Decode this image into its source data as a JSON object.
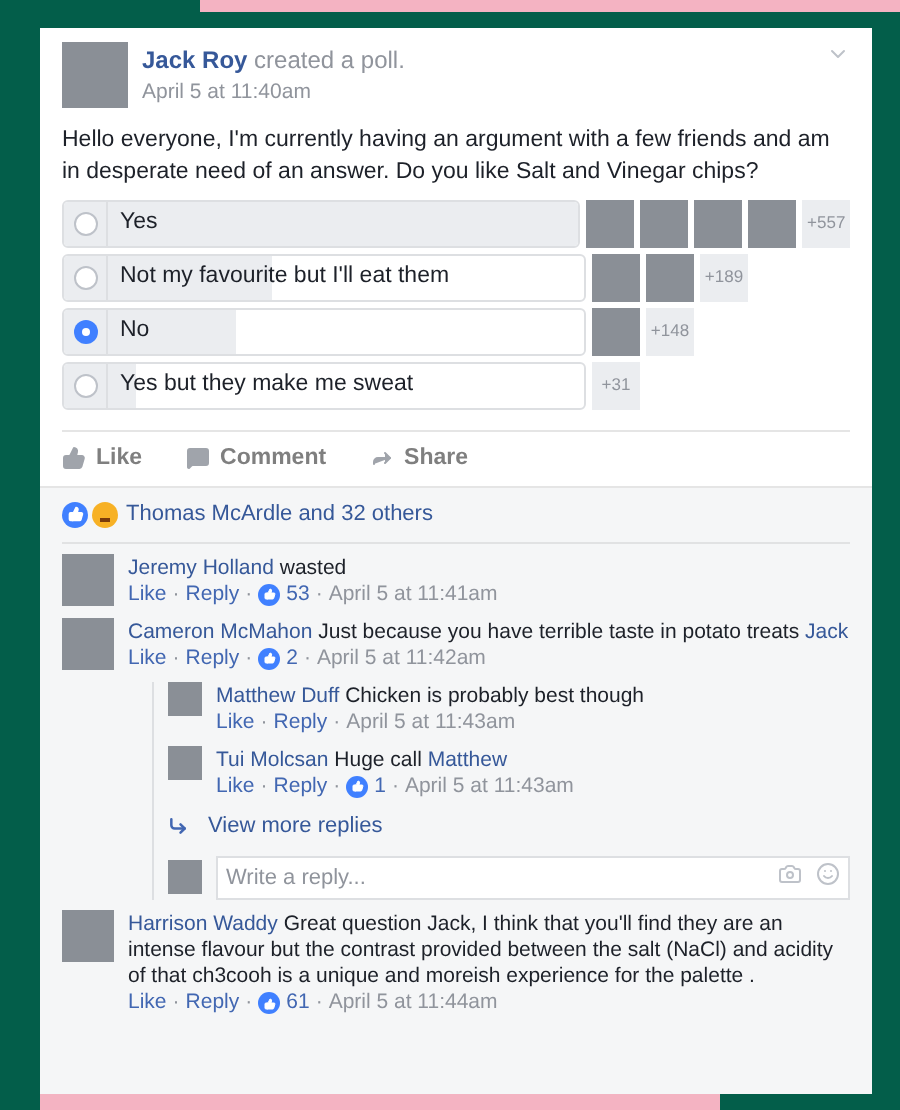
{
  "post": {
    "author": "Jack Roy",
    "action": "created a poll.",
    "time": "April 5 at 11:40am",
    "text": "Hello everyone, I'm currently having an argument with a few friends and am in desperate need of an answer. Do you like Salt and Vinegar chips?"
  },
  "poll_options": [
    {
      "label": "Yes",
      "selected": false,
      "level": 1.0,
      "voter_photos": [
        {
          "kind": "photo"
        },
        {
          "kind": "photo"
        },
        {
          "kind": "photo"
        },
        {
          "kind": "photo"
        }
      ],
      "more": "+557"
    },
    {
      "label": "Not my favourite but I'll eat them",
      "selected": false,
      "level": 0.4,
      "voter_photos": [
        {
          "kind": "photo"
        },
        {
          "kind": "photo"
        }
      ],
      "more": "+189"
    },
    {
      "label": "No",
      "selected": true,
      "level": 0.33,
      "voter_photos": [
        {
          "kind": "photo"
        }
      ],
      "more": "+148"
    },
    {
      "label": "Yes but they make me sweat",
      "selected": false,
      "level": 0.14,
      "more": "+31"
    }
  ],
  "actions": [
    "Like",
    "Comment",
    "Share"
  ],
  "reactions": {
    "text": "Thomas McArdle and 32 others"
  },
  "comments": [
    {
      "author": "Jeremy Holland",
      "parts": [
        {
          "kind": "text",
          "text": "wasted"
        }
      ],
      "like": "Like",
      "separator": "·",
      "reply": "Reply",
      "likes": "53",
      "time": "April 5 at 11:41am"
    },
    {
      "author": "Cameron McMahon",
      "parts": [
        {
          "kind": "text",
          "text": "Just because you have terrible taste in potato treats"
        },
        {
          "kind": "mention",
          "text": "Jack"
        }
      ],
      "like": "Like",
      "separator": "·",
      "reply": "Reply",
      "likes": "2",
      "time": "April 5 at 11:42am",
      "replies": [
        {
          "author": "Matthew Duff",
          "parts": [
            {
              "kind": "text",
              "text": "Chicken is probably best though"
            }
          ],
          "like": "Like",
          "separator": "·",
          "reply": "Reply",
          "time": "April 5 at 11:43am"
        },
        {
          "author": "Tui Molcsan",
          "parts": [
            {
              "kind": "text",
              "text": "Huge call"
            },
            {
              "kind": "mention",
              "text": "Matthew"
            }
          ],
          "like": "Like",
          "separator": "·",
          "reply": "Reply",
          "likes": "1",
          "time": "April 5 at 11:43am"
        }
      ],
      "view_more": "View more replies",
      "reply_placeholder": "Write a reply..."
    },
    {
      "author": "Harrison Waddy",
      "parts": [
        {
          "kind": "text",
          "text": "Great question Jack, I think that you'll find they are an intense flavour but the contrast provided between the salt (NaCl) and acidity of that ch3cooh is a unique and moreish experience for the palette ."
        }
      ],
      "like": "Like",
      "separator": "·",
      "reply": "Reply",
      "likes": "61",
      "time": "April 5 at 11:44am"
    }
  ]
}
